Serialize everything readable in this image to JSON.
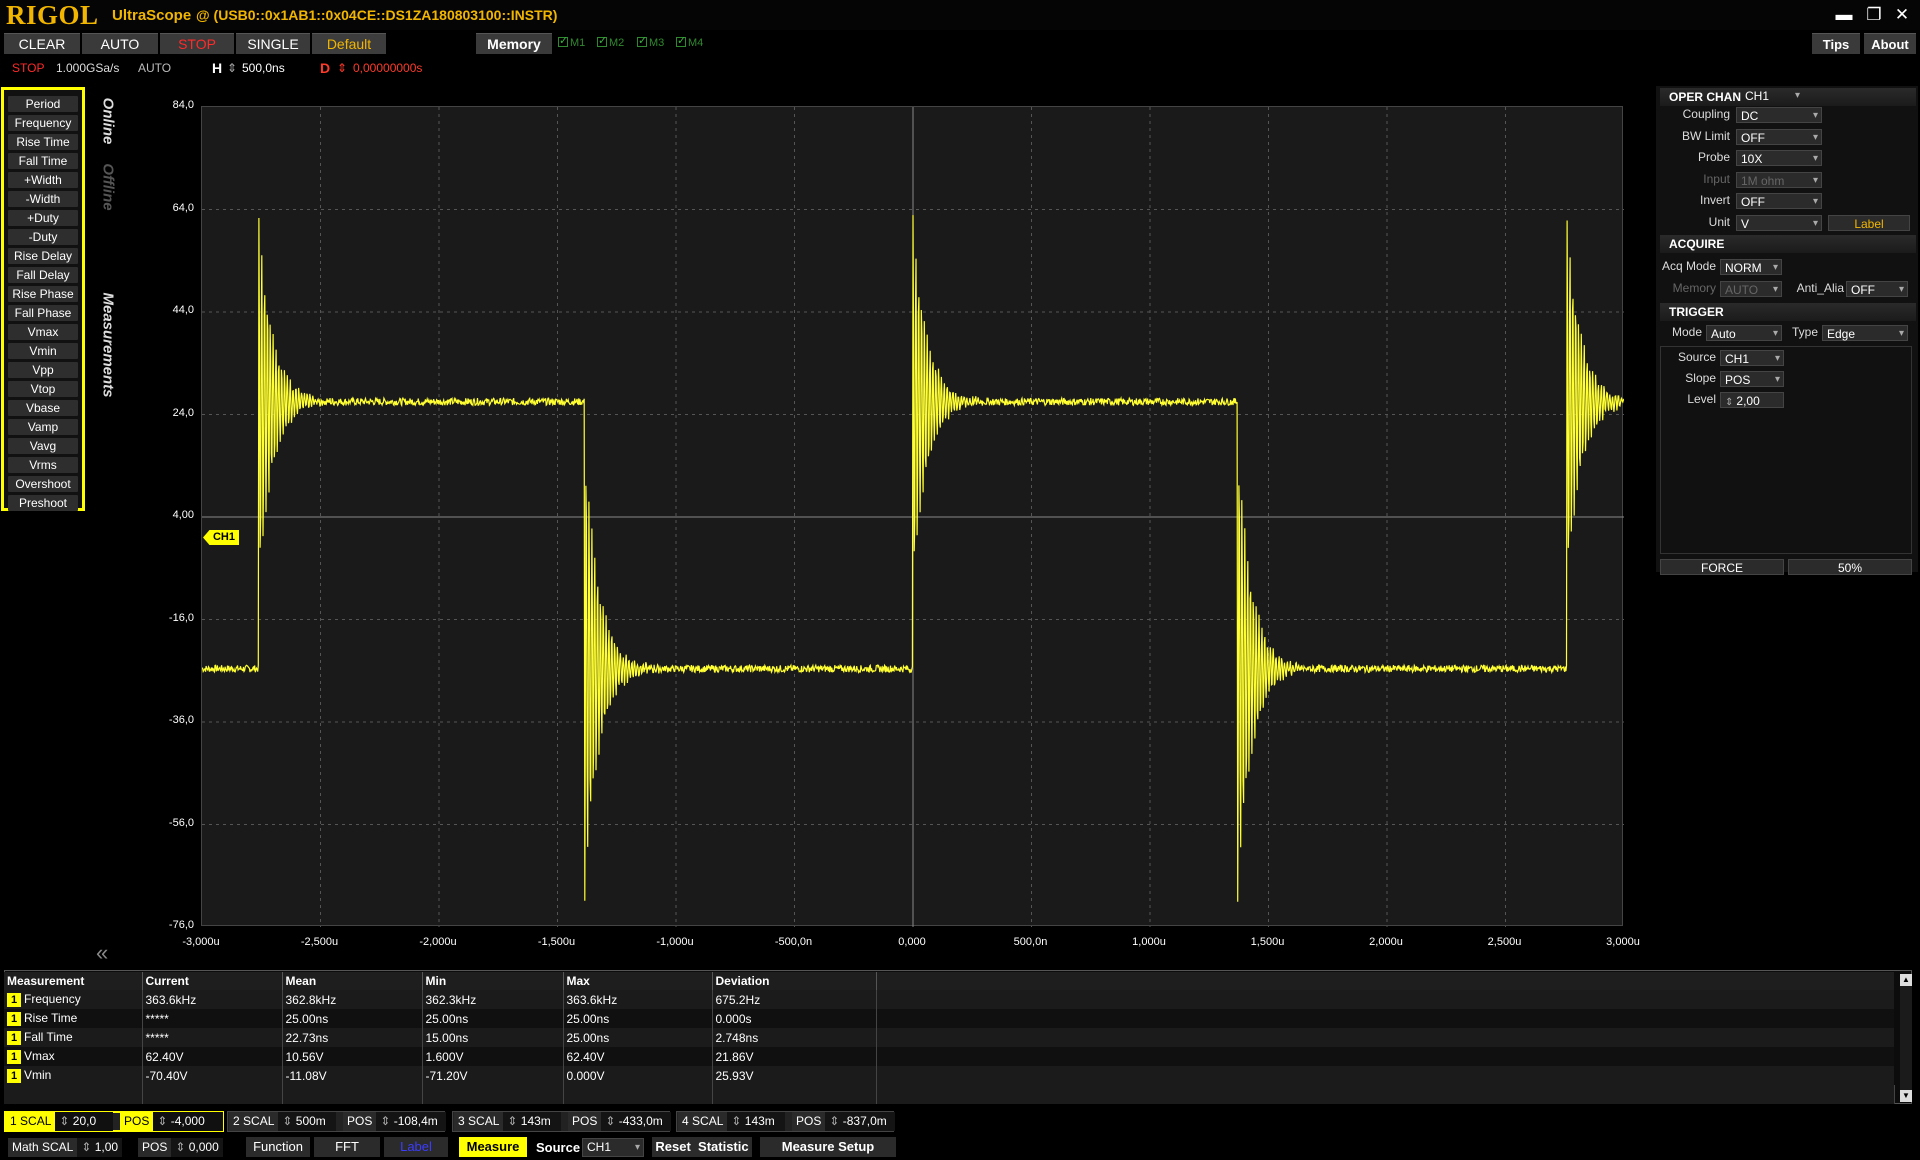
{
  "title": {
    "brand": "RIGOL",
    "app": "UltraScope",
    "connection": "@ (USB0::0x1AB1::0x04CE::DS1ZA180803100::INSTR)",
    "window_controls": [
      "minimize-icon",
      "restore-icon",
      "close-icon"
    ]
  },
  "toolbar": {
    "clear": "CLEAR",
    "auto": "AUTO",
    "stop": "STOP",
    "single": "SINGLE",
    "default": "Default",
    "memory": "Memory",
    "m1": "M1",
    "m2": "M2",
    "m3": "M3",
    "m4": "M4",
    "tips": "Tips",
    "about": "About"
  },
  "status": {
    "state": "STOP",
    "rate": "1.000GSa/s",
    "mode": "AUTO",
    "h_label": "H",
    "h_value": "500,0ns",
    "d_label": "D",
    "d_value": "0,00000000s"
  },
  "measure_list": [
    "Period",
    "Frequency",
    "Rise Time",
    "Fall Time",
    "+Width",
    "-Width",
    "+Duty",
    "-Duty",
    "Rise Delay",
    "Fall Delay",
    "Rise Phase",
    "Fall Phase",
    "Vmax",
    "Vmin",
    "Vpp",
    "Vtop",
    "Vbase",
    "Vamp",
    "Vavg",
    "Vrms",
    "Overshoot",
    "Preshoot"
  ],
  "tabs": {
    "online": "Online",
    "offline": "Offline",
    "measurements": "Measurements"
  },
  "plot": {
    "y_ticks": [
      "84,0",
      "64,0",
      "44,0",
      "24,0",
      "4,00",
      "-16,0",
      "-36,0",
      "-56,0",
      "-76,0"
    ],
    "x_ticks": [
      "-3,000u",
      "-2,500u",
      "-2,000u",
      "-1,500u",
      "-1,000u",
      "-500,0n",
      "0,000",
      "500,0n",
      "1,000u",
      "1,500u",
      "2,000u",
      "2,500u",
      "3,000u"
    ],
    "channel_marker": "CH1",
    "trace_color": "#ffff33",
    "collapse_icon": "double-chevron-left-icon"
  },
  "chart_data": {
    "type": "line",
    "title": "",
    "xlabel": "",
    "ylabel": "",
    "x_unit": "s",
    "xlim": [
      -3e-06,
      3e-06
    ],
    "ylim": [
      -76,
      84
    ],
    "grid": true,
    "series": [
      {
        "description_points": [
          [
            -3e-06,
            -25.6
          ],
          [
            -2.78e-06,
            -25.6
          ],
          [
            -2.76e-06,
            -20
          ],
          [
            -2.74e-06,
            62.4
          ],
          [
            -2.72e-06,
            30
          ],
          [
            -2.68e-06,
            26
          ],
          [
            -1.4e-06,
            26.5
          ],
          [
            -1.39e-06,
            24
          ],
          [
            -1.37e-06,
            -70.4
          ],
          [
            -1.35e-06,
            -22
          ],
          [
            -1.3e-06,
            -25.6
          ],
          [
            0.0,
            -25.6
          ],
          [
            5e-09,
            62.4
          ],
          [
            3e-08,
            28
          ],
          [
            8e-08,
            26.5
          ],
          [
            1.34e-06,
            26.5
          ],
          [
            1.36e-06,
            24
          ],
          [
            1.37e-06,
            -70.4
          ],
          [
            1.4e-06,
            -22
          ],
          [
            1.45e-06,
            -25.6
          ],
          [
            2.73e-06,
            -25.6
          ],
          [
            2.76e-06,
            62.4
          ],
          [
            2.8e-06,
            28
          ],
          [
            3e-06,
            26.5
          ]
        ]
      }
    ]
  },
  "right_panel": {
    "oper_chan": {
      "header": "OPER CHAN",
      "value": "CH1"
    },
    "coupling": {
      "label": "Coupling",
      "value": "DC"
    },
    "bw_limit": {
      "label": "BW Limit",
      "value": "OFF"
    },
    "probe": {
      "label": "Probe",
      "value": "10X"
    },
    "input": {
      "label": "Input",
      "value": "1M ohm"
    },
    "invert": {
      "label": "Invert",
      "value": "OFF"
    },
    "unit": {
      "label": "Unit",
      "value": "V",
      "button": "Label"
    },
    "acquire": {
      "header": "ACQUIRE",
      "acq_mode_label": "Acq Mode",
      "acq_mode": "NORM",
      "memory_label": "Memory",
      "memory": "AUTO",
      "anti_alias_label": "Anti_Alia",
      "anti_alias": "OFF"
    },
    "trigger": {
      "header": "TRIGGER",
      "mode_label": "Mode",
      "mode": "Auto",
      "type_label": "Type",
      "type": "Edge",
      "source_label": "Source",
      "source": "CH1",
      "slope_label": "Slope",
      "slope": "POS",
      "level_label": "Level",
      "level": "2,00",
      "force": "FORCE",
      "fifty": "50%"
    }
  },
  "measure_table": {
    "headers": [
      "Measurement",
      "Current",
      "Mean",
      "Min",
      "Max",
      "Deviation"
    ],
    "rows": [
      {
        "ch": "1",
        "name": "Frequency",
        "current": "363.6kHz",
        "mean": "362.8kHz",
        "min": "362.3kHz",
        "max": "363.6kHz",
        "dev": "675.2Hz"
      },
      {
        "ch": "1",
        "name": "Rise Time",
        "current": "*****",
        "mean": "25.00ns",
        "min": "25.00ns",
        "max": "25.00ns",
        "dev": "0.000s"
      },
      {
        "ch": "1",
        "name": "Fall Time",
        "current": "*****",
        "mean": "22.73ns",
        "min": "15.00ns",
        "max": "25.00ns",
        "dev": "2.748ns"
      },
      {
        "ch": "1",
        "name": "Vmax",
        "current": "62.40V",
        "mean": "10.56V",
        "min": "1.600V",
        "max": "62.40V",
        "dev": "21.86V"
      },
      {
        "ch": "1",
        "name": "Vmin",
        "current": "-70.40V",
        "mean": "-11.08V",
        "min": "-71.20V",
        "max": "0.000V",
        "dev": "25.93V"
      }
    ]
  },
  "channels": [
    {
      "num": "1",
      "scal_label": "SCAL",
      "scal": "20,0",
      "pos_label": "POS",
      "pos": "-4,000"
    },
    {
      "num": "2",
      "scal_label": "SCAL",
      "scal": "500m",
      "pos_label": "POS",
      "pos": "-108,4m"
    },
    {
      "num": "3",
      "scal_label": "SCAL",
      "scal": "143m",
      "pos_label": "POS",
      "pos": "-433,0m"
    },
    {
      "num": "4",
      "scal_label": "SCAL",
      "scal": "143m",
      "pos_label": "POS",
      "pos": "-837,0m"
    }
  ],
  "bottom": {
    "math_scal_label": "Math SCAL",
    "math_scal": "1,00",
    "pos_label": "POS",
    "pos": "0,000",
    "function": "Function",
    "fft": "FFT",
    "label": "Label",
    "measure": "Measure",
    "source_label": "Source",
    "source": "CH1",
    "reset": "Reset",
    "statistic": "Statistic",
    "measure_setup": "Measure Setup"
  }
}
